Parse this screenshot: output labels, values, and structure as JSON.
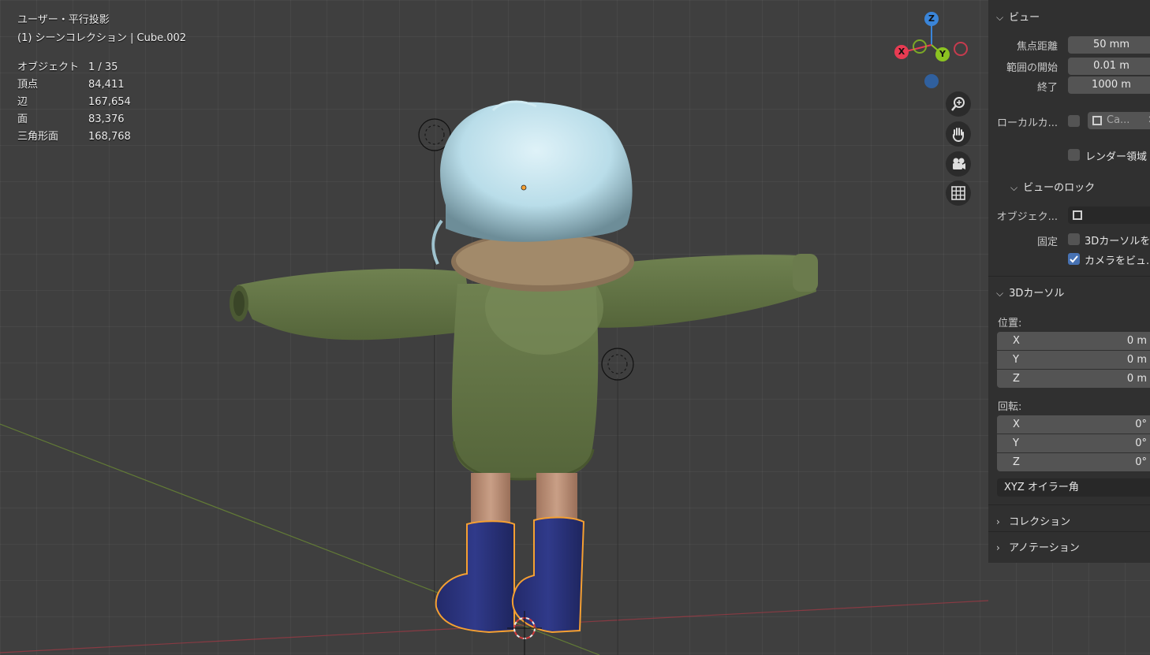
{
  "viewport": {
    "view_title": "ユーザー・平行投影",
    "collection_line": "(1) シーンコレクション | Cube.002",
    "stats": [
      {
        "label": "オブジェクト",
        "value": "1 / 35"
      },
      {
        "label": "頂点",
        "value": "84,411"
      },
      {
        "label": "辺",
        "value": "167,654"
      },
      {
        "label": "面",
        "value": "83,376"
      },
      {
        "label": "三角形面",
        "value": "168,768"
      }
    ],
    "gizmo": {
      "x": "X",
      "y": "Y",
      "z": "Z"
    }
  },
  "nav_icons": [
    "zoom-icon",
    "pan-hand-icon",
    "camera-icon",
    "grid-toggle-icon"
  ],
  "sidebar": {
    "view_section": {
      "title": "ビュー",
      "focal_length_label": "焦点距離",
      "focal_length_value": "50 mm",
      "clip_start_label": "範囲の開始",
      "clip_start_value": "0.01 m",
      "clip_end_label": "終了",
      "clip_end_value": "1000 m",
      "local_camera_label": "ローカルカ...",
      "local_camera_value": "Ca...",
      "render_region_label": "レンダー領域"
    },
    "view_lock_section": {
      "title": "ビューのロック",
      "object_label": "オブジェク...",
      "lock_label": "固定",
      "lock_3d_cursor_label": "3Dカーソルを",
      "lock_camera_label": "カメラをビュ...",
      "lock_camera_checked": true
    },
    "cursor_section": {
      "title": "3Dカーソル",
      "location_label": "位置:",
      "location": [
        {
          "axis": "X",
          "value": "0 m"
        },
        {
          "axis": "Y",
          "value": "0 m"
        },
        {
          "axis": "Z",
          "value": "0 m"
        }
      ],
      "rotation_label": "回転:",
      "rotation": [
        {
          "axis": "X",
          "value": "0°"
        },
        {
          "axis": "Y",
          "value": "0°"
        },
        {
          "axis": "Z",
          "value": "0°"
        }
      ],
      "rotation_mode": "XYZ オイラー角"
    },
    "collection_section": {
      "title": "コレクション"
    },
    "annotation_section": {
      "title": "アノテーション"
    }
  },
  "colors": {
    "x_axis": "#e83b52",
    "y_axis": "#8bc321",
    "z_axis": "#3a85d9",
    "selection_outline": "#f5a032",
    "accent": "#4772b3"
  }
}
